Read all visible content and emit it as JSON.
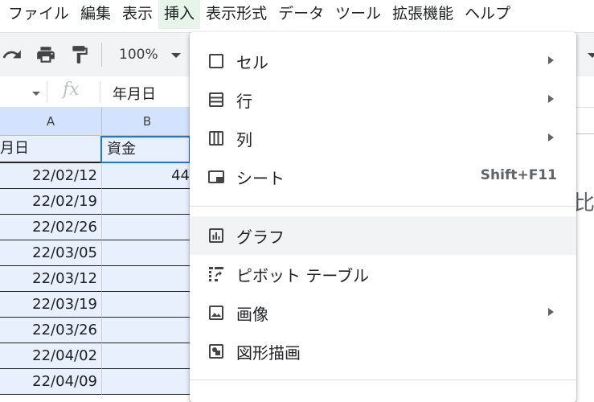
{
  "menubar": {
    "items": [
      "ファイル",
      "編集",
      "表示",
      "挿入",
      "表示形式",
      "データ",
      "ツール",
      "拡張機能",
      "ヘルプ"
    ],
    "active_index": 3
  },
  "toolbar": {
    "zoom": "100%",
    "icons": [
      "redo-icon",
      "print-icon",
      "paint-format-icon"
    ]
  },
  "formula_bar": {
    "fx_symbol": "fx",
    "value": "年月日"
  },
  "grid": {
    "columns": [
      "A",
      "B"
    ],
    "header_row": [
      "月日",
      "資金"
    ],
    "rows": [
      {
        "a": "22/02/12",
        "b": "44"
      },
      {
        "a": "22/02/19",
        "b": ""
      },
      {
        "a": "22/02/26",
        "b": ""
      },
      {
        "a": "22/03/05",
        "b": ""
      },
      {
        "a": "22/03/12",
        "b": ""
      },
      {
        "a": "22/03/19",
        "b": ""
      },
      {
        "a": "22/03/26",
        "b": ""
      },
      {
        "a": "22/04/02",
        "b": ""
      },
      {
        "a": "22/04/09",
        "b": ""
      }
    ],
    "peek_char": "比"
  },
  "insert_menu": {
    "items": [
      {
        "label": "セル",
        "icon": "cell-icon",
        "submenu": true
      },
      {
        "label": "行",
        "icon": "rows-icon",
        "submenu": true
      },
      {
        "label": "列",
        "icon": "columns-icon",
        "submenu": true
      },
      {
        "label": "シート",
        "icon": "sheet-icon",
        "shortcut": "Shift+F11"
      },
      {
        "label": "グラフ",
        "icon": "chart-icon"
      },
      {
        "label": "ピボット テーブル",
        "icon": "pivot-table-icon"
      },
      {
        "label": "画像",
        "icon": "image-icon",
        "submenu": true
      },
      {
        "label": "図形描画",
        "icon": "drawing-icon"
      }
    ]
  },
  "colors": {
    "active_menu_bg": "#e6f4ea",
    "selection_bg": "#e8f0fe",
    "col_header_selected": "#d3e3fd",
    "selection_border": "#1a73e8"
  }
}
